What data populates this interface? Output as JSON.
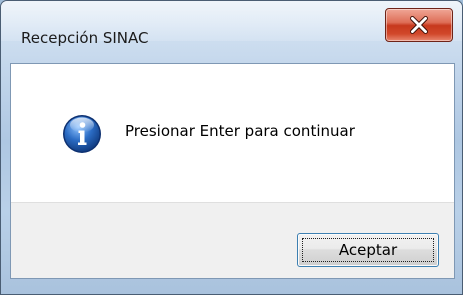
{
  "window": {
    "title": "Recepción SINAC",
    "close_icon": "close-icon"
  },
  "message": {
    "icon": "info-icon",
    "text": "Presionar Enter para continuar"
  },
  "buttons": {
    "accept_label": "Aceptar"
  },
  "colors": {
    "close_button": "#c7381c",
    "info_icon": "#2b6cc4",
    "focus_border": "#3c7fb1"
  }
}
